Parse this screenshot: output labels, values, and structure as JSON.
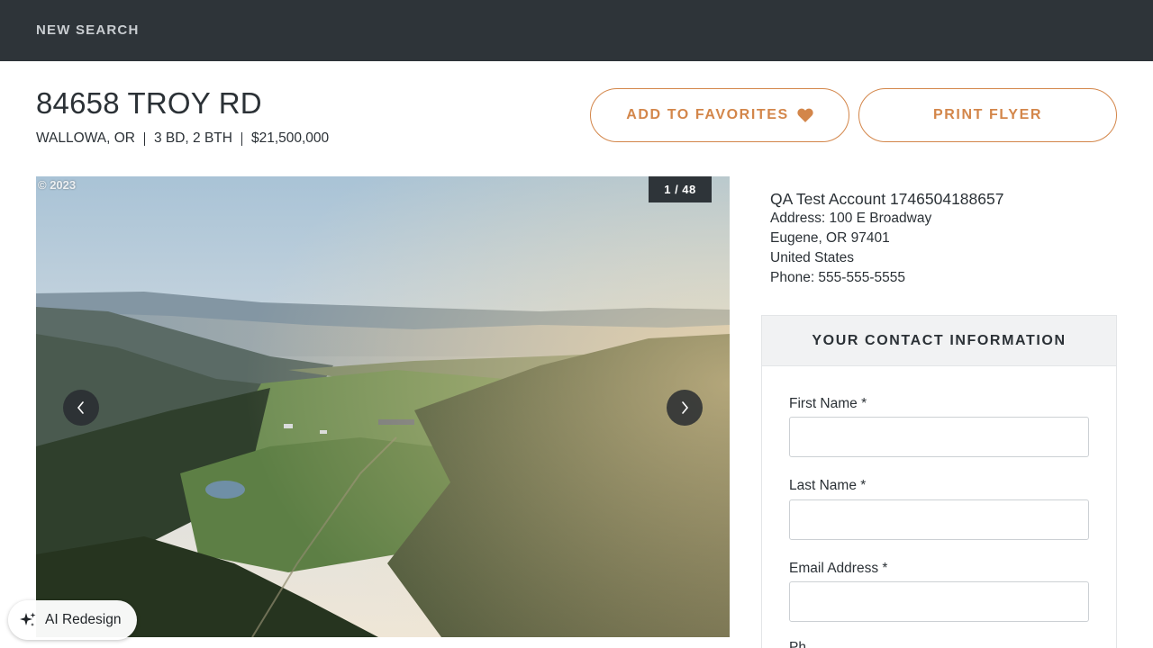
{
  "header": {
    "new_search": "NEW SEARCH"
  },
  "listing": {
    "address": "84658 TROY RD",
    "location": "WALLOWA, OR",
    "beds_baths": "3 BD, 2 BTH",
    "price": "$21,500,000"
  },
  "actions": {
    "favorites_label": "ADD TO FAVORITES",
    "print_label": "PRINT FLYER"
  },
  "gallery": {
    "copyright": "© 2023",
    "counter": "1 / 48"
  },
  "agent": {
    "name": "QA Test Account 1746504188657",
    "address": "Address: 100 E Broadway",
    "city": "Eugene, OR 97401",
    "country": "United States",
    "phone": "Phone: 555-555-5555"
  },
  "contact_form": {
    "title": "YOUR CONTACT INFORMATION",
    "first_name_label": "First Name *",
    "first_name_value": "",
    "last_name_label": "Last Name *",
    "last_name_value": "",
    "email_label": "Email Address *",
    "email_value": "",
    "phone_label_partial": "Ph"
  },
  "ai_button": {
    "label": "AI Redesign"
  },
  "colors": {
    "accent": "#d3864a",
    "topbar": "#2e3439"
  },
  "icons": [
    "heart-icon",
    "chevron-left-icon",
    "chevron-right-icon",
    "sparkle-icon"
  ]
}
